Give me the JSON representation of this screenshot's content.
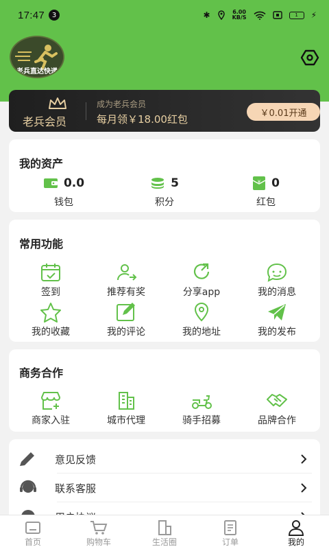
{
  "status_bar": {
    "time": "17:47",
    "notification_count": "3",
    "net_speed_value": "6.00",
    "net_speed_unit": "KB/S",
    "battery": "1"
  },
  "profile": {
    "avatar_text": "老兵直达快递"
  },
  "vip": {
    "title": "老兵会员",
    "subtitle": "成为老兵会员",
    "offer": "每月领￥18.00红包",
    "button": "￥0.01开通"
  },
  "assets": {
    "title": "我的资产",
    "items": [
      {
        "value": "0.0",
        "label": "钱包",
        "icon": "wallet-icon"
      },
      {
        "value": "5",
        "label": "积分",
        "icon": "coins-icon"
      },
      {
        "value": "0",
        "label": "红包",
        "icon": "red-packet-icon"
      }
    ]
  },
  "common_functions": {
    "title": "常用功能",
    "items": [
      {
        "label": "签到",
        "icon": "calendar-check-icon"
      },
      {
        "label": "推荐有奖",
        "icon": "user-refer-icon"
      },
      {
        "label": "分享app",
        "icon": "share-icon"
      },
      {
        "label": "我的消息",
        "icon": "message-icon"
      },
      {
        "label": "我的收藏",
        "icon": "star-icon"
      },
      {
        "label": "我的评论",
        "icon": "edit-icon"
      },
      {
        "label": "我的地址",
        "icon": "location-icon"
      },
      {
        "label": "我的发布",
        "icon": "send-icon"
      }
    ]
  },
  "business": {
    "title": "商务合作",
    "items": [
      {
        "label": "商家入驻",
        "icon": "shop-add-icon"
      },
      {
        "label": "城市代理",
        "icon": "buildings-icon"
      },
      {
        "label": "骑手招募",
        "icon": "scooter-icon"
      },
      {
        "label": "品牌合作",
        "icon": "handshake-icon"
      }
    ]
  },
  "menu_list": [
    {
      "label": "意见反馈",
      "icon": "pencil-icon"
    },
    {
      "label": "联系客服",
      "icon": "headset-icon"
    },
    {
      "label": "用户协议",
      "icon": "info-icon"
    }
  ],
  "tabbar": {
    "items": [
      {
        "label": "首页",
        "icon": "home-icon"
      },
      {
        "label": "购物车",
        "icon": "cart-icon"
      },
      {
        "label": "生活圈",
        "icon": "building-icon"
      },
      {
        "label": "订单",
        "icon": "order-icon"
      },
      {
        "label": "我的",
        "icon": "user-icon"
      }
    ],
    "active_index": 4
  },
  "colors": {
    "accent": "#62c14a",
    "vip_gold": "#e7cfa2",
    "vip_button": "#f6d6b5"
  }
}
